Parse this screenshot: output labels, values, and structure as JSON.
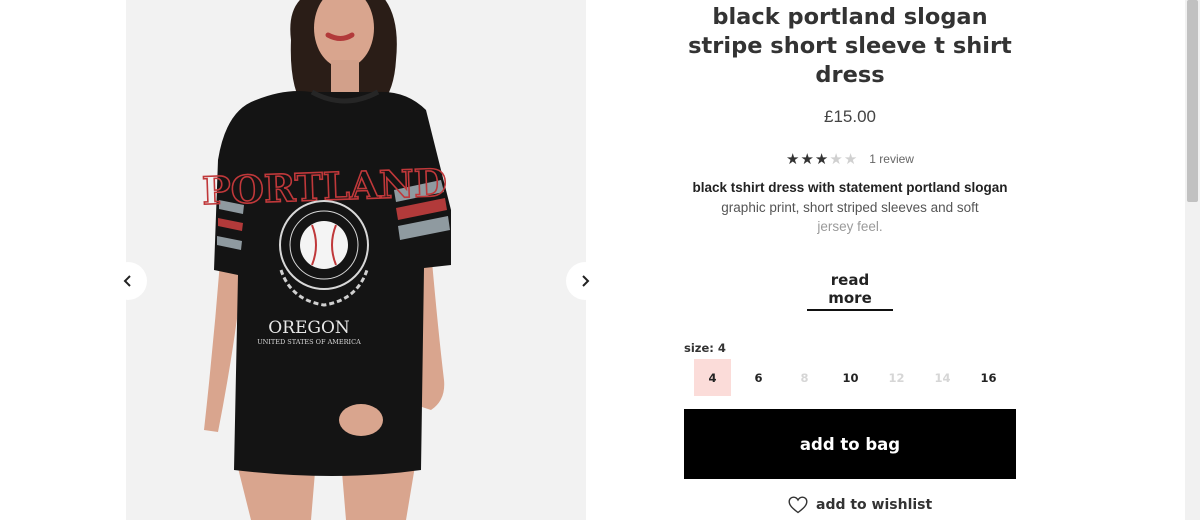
{
  "product": {
    "title_lines": [
      "black portland slogan",
      "stripe short sleeve t shirt",
      "dress"
    ],
    "price": "£15.00",
    "rating": {
      "stars": 3,
      "max": 5,
      "review_text": "1 review"
    },
    "description_lines": [
      "black tshirt dress with statement portland slogan",
      "graphic print, short striped sleeves and soft",
      "jersey feel."
    ],
    "read_more": "read more"
  },
  "print": {
    "slogan": "PORTLAND",
    "state": "OREGON",
    "country": "UNITED STATES OF AMERICA"
  },
  "size": {
    "label": "size: 4",
    "options": [
      {
        "label": "4",
        "state": "selected"
      },
      {
        "label": "6",
        "state": "available"
      },
      {
        "label": "8",
        "state": "disabled"
      },
      {
        "label": "10",
        "state": "available"
      },
      {
        "label": "12",
        "state": "disabled"
      },
      {
        "label": "14",
        "state": "disabled"
      },
      {
        "label": "16",
        "state": "available"
      }
    ]
  },
  "actions": {
    "add_to_bag": "add to bag",
    "wishlist": "add to wishlist"
  },
  "icons": {
    "prev": "chevron-left-icon",
    "next": "chevron-right-icon",
    "wishlist": "heart-icon"
  },
  "colors": {
    "selected_size_bg": "#fbdcd9",
    "button_bg": "#000000",
    "disabled_size": "#d6d6d6"
  }
}
